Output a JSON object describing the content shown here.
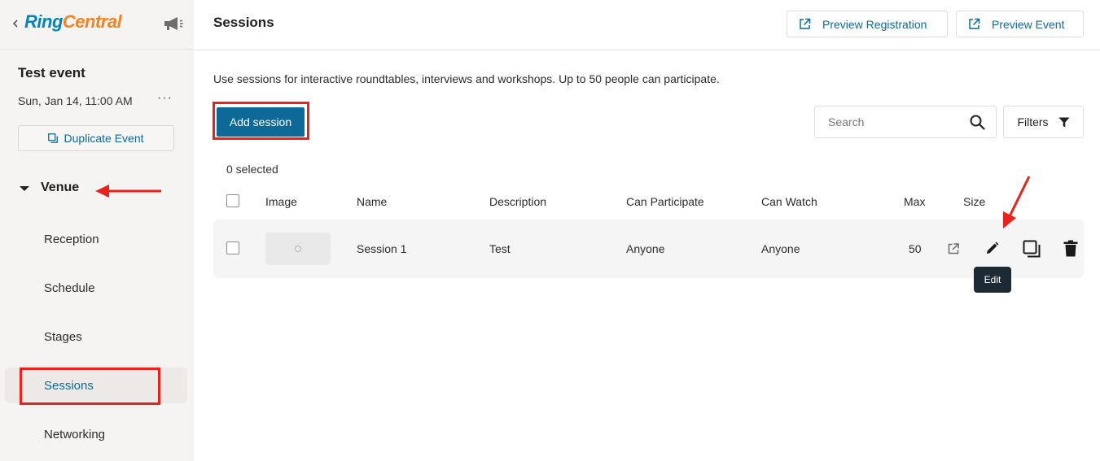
{
  "brand": {
    "logo_ring": "Ring",
    "logo_central": "Central",
    "colors": {
      "ring": "#0684bc",
      "central": "#f58220",
      "accent": "#0d6a98",
      "annotation": "#e8231d"
    }
  },
  "sidebar": {
    "event_title": "Test event",
    "event_date": "Sun, Jan 14, 11:00 AM",
    "more_label": "···",
    "duplicate_label": "Duplicate Event",
    "venue_label": "Venue",
    "items": [
      {
        "label": "Reception",
        "active": false
      },
      {
        "label": "Schedule",
        "active": false
      },
      {
        "label": "Stages",
        "active": false
      },
      {
        "label": "Sessions",
        "active": true
      },
      {
        "label": "Networking",
        "active": false
      }
    ]
  },
  "header": {
    "title": "Sessions",
    "preview_registration": "Preview Registration",
    "preview_event": "Preview Event"
  },
  "main": {
    "intro": "Use sessions for interactive roundtables, interviews and workshops. Up to 50 people can participate.",
    "add_session": "Add session",
    "search_placeholder": "Search",
    "filters_label": "Filters",
    "selected_count": "0 selected"
  },
  "table": {
    "columns": [
      "Image",
      "Name",
      "Description",
      "Can Participate",
      "Can Watch",
      "Max",
      "Size"
    ],
    "rows": [
      {
        "name": "Session 1",
        "description": "Test",
        "can_participate": "Anyone",
        "can_watch": "Anyone",
        "max": "50"
      }
    ],
    "row_actions": [
      "open-external-icon",
      "pencil-edit-icon",
      "duplicate-icon",
      "trash-icon"
    ]
  },
  "tooltip": {
    "text": "Edit"
  }
}
